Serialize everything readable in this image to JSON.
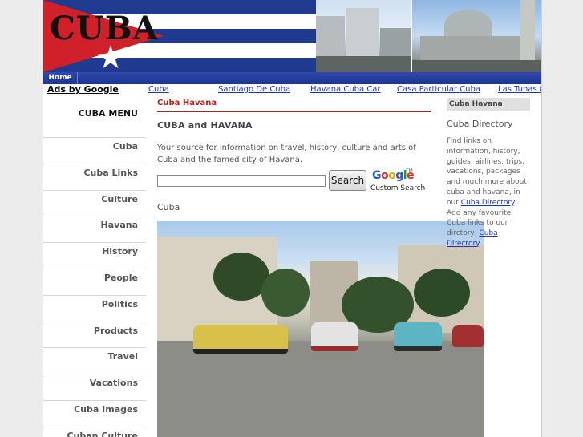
{
  "header": {
    "title": "CUBA"
  },
  "nav": {
    "home": "Home"
  },
  "ads": {
    "label": "Ads by Google",
    "links": [
      "Cuba",
      "Santiago De Cuba",
      "Havana Cuba Car",
      "Casa Particular Cuba",
      "Las Tunas C"
    ]
  },
  "menu": {
    "title": "CUBA MENU",
    "items": [
      "Cuba",
      "Cuba Links",
      "Culture",
      "Havana",
      "History",
      "People",
      "Politics",
      "Products",
      "Travel",
      "Vacations",
      "Cuba Images",
      "Cuban Culture"
    ]
  },
  "main": {
    "breadcrumb": "Cuba Havana",
    "heading": "CUBA and HAVANA",
    "intro": "Your source for information on travel, history, culture and arts of Cuba and the famed city of Havana.",
    "search_button": "Search",
    "google_logo": "Google",
    "google_custom": "Custom Search",
    "section_label": "Cuba"
  },
  "right": {
    "box_title": "Cuba Havana",
    "title": "Cuba Directory",
    "text_1": "Find links on information, history, guides, airlines, trips, vacations, packages and much more about cuba and havana, in our",
    "link_1": "Cuba Directory",
    "text_2": ". Add any favourite Cuba links to our dirctory,",
    "link_2": "Cuba Directory",
    "text_3": "."
  }
}
